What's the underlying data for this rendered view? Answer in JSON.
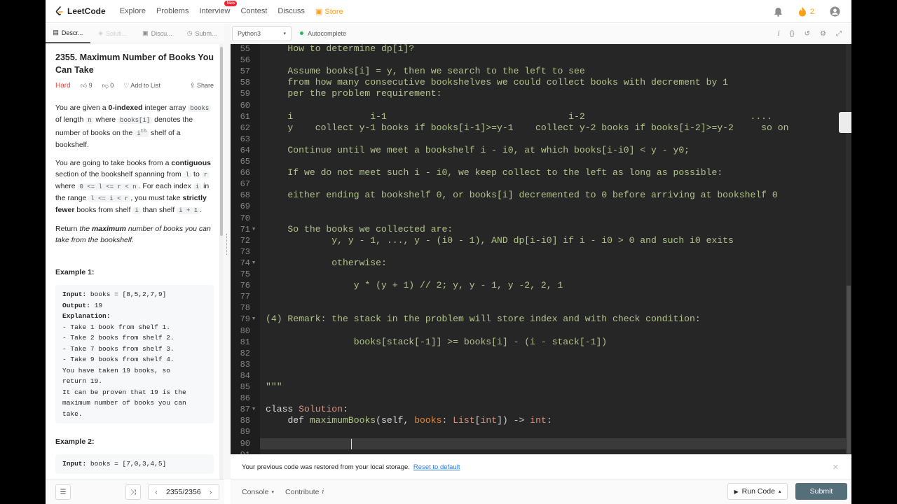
{
  "nav": {
    "logo": "LeetCode",
    "items": [
      "Explore",
      "Problems",
      "Interview",
      "Contest",
      "Discuss"
    ],
    "new_badge": "New",
    "store": "Store",
    "streak_count": "2"
  },
  "left_tabs": [
    "Descr...",
    "Soluti...",
    "Discu...",
    "Subm..."
  ],
  "problem": {
    "title": "2355. Maximum Number of Books You Can Take",
    "difficulty": "Hard",
    "likes": "9",
    "dislikes": "0",
    "add_to_list": "Add to List",
    "share": "Share",
    "p1": {
      "a": "You are given a ",
      "b": "0-indexed",
      "c": " integer array ",
      "d": "books",
      "e": " of length ",
      "f": "n",
      "g": " where ",
      "h": "books[i]",
      "i": " denotes the number of books on the ",
      "j": "i",
      "k": "th",
      "l": " shelf of a bookshelf."
    },
    "p2": {
      "a": "You are going to take books from a ",
      "b": "contiguous",
      "c": " section of the bookshelf spanning from ",
      "d": "l",
      "e": " to ",
      "f": "r",
      "g": " where ",
      "h": "0 <= l <= r < n",
      "i": ". For each index ",
      "j": "i",
      "k": " in the range ",
      "l": "l <= i < r",
      "m": ", you must take ",
      "n": "strictly fewer",
      "o": " books from shelf ",
      "p": "i",
      "q": " than shelf ",
      "r": "i + 1",
      "s": "."
    },
    "p3": {
      "a": "Return ",
      "b": "the ",
      "c": "maximum",
      "d": " number of books you can take from the bookshelf."
    },
    "example1_title": "Example 1:",
    "example1_lines": [
      {
        "label": "Input:",
        "text": " books = [8,5,2,7,9]"
      },
      {
        "label": "Output:",
        "text": " 19"
      },
      {
        "label": "Explanation:",
        "text": ""
      },
      {
        "label": "",
        "text": "- Take 1 book from shelf 1."
      },
      {
        "label": "",
        "text": "- Take 2 books from shelf 2."
      },
      {
        "label": "",
        "text": "- Take 7 books from shelf 3."
      },
      {
        "label": "",
        "text": "- Take 9 books from shelf 4."
      },
      {
        "label": "",
        "text": "You have taken 19 books, so"
      },
      {
        "label": "",
        "text": "return 19."
      },
      {
        "label": "",
        "text": "It can be proven that 19 is the"
      },
      {
        "label": "",
        "text": "maximum number of books you can"
      },
      {
        "label": "",
        "text": "take."
      }
    ],
    "example2_title": "Example 2:",
    "example2_first": {
      "label": "Input:",
      "text": " books = [7,0,3,4,5]"
    }
  },
  "editor": {
    "language": "Python3",
    "autocomplete": "Autocomplete",
    "line_numbers": [
      "55",
      "56",
      "57",
      "58",
      "59",
      "60",
      "61",
      "62",
      "63",
      "64",
      "65",
      "66",
      "67",
      "68",
      "69",
      "70",
      "71",
      "72",
      "73",
      "74",
      "75",
      "76",
      "77",
      "78",
      "79",
      "80",
      "81",
      "82",
      "83",
      "84",
      "85",
      "86",
      "87",
      "88",
      "89",
      "90",
      "91"
    ],
    "lines": [
      "    How to determine dp[i]?",
      "",
      "    Assume books[i] = y, then we search to the left to see",
      "    from how many consecutive bookshelves we could collect books with decrement by 1",
      "    per the problem requirement:",
      "",
      "    i              i-1                                 i-2                              ....",
      "    y    collect y-1 books if books[i-1]>=y-1    collect y-2 books if books[i-2]>=y-2     so on",
      "",
      "    Continue until we meet a bookshelf i - i0, at which books[i-i0] < y - y0;",
      "",
      "    If we do not meet such i - i0, we keep collect to the left as long as possible:",
      "",
      "    either ending at bookshelf 0, or books[i] decremented to 0 before arriving at bookshelf 0",
      "",
      "",
      "    So the books we collected are:",
      "            y, y - 1, ..., y - (i0 - 1), AND dp[i-i0] if i - i0 > 0 and such i0 exits",
      "",
      "            otherwise:",
      "",
      "                y * (y + 1) // 2; y, y - 1, y -2, 2, 1",
      "",
      "",
      "(4) Remark: the stack in the problem will store index and with check condition:",
      "",
      "                books[stack[-1]] >= books[i] - (i - stack[-1])",
      "",
      "",
      "",
      "\"\"\"",
      "",
      "",
      "",
      "",
      "",
      ""
    ],
    "code": {
      "class_kw": "class",
      "class_name": "Solution",
      "colon": ":",
      "def_kw": "def",
      "fn_name": "maximumBooks",
      "open": "(self, ",
      "param": "books",
      "sep": ": ",
      "type_list": "List",
      "bracket_open": "[",
      "type_int": "int",
      "bracket_close": "])",
      "arrow": " -> ",
      "ret": "int",
      "end": ":"
    }
  },
  "notice": {
    "text": "Your previous code was restored from your local storage.",
    "reset": "Reset to default"
  },
  "bottom": {
    "pager": "2355/2356",
    "console": "Console",
    "contribute": "Contribute",
    "run": "Run Code",
    "submit": "Submit"
  },
  "colors": {
    "accent": "#ffa116",
    "hard": "#ef4743",
    "submit": "#546e7a",
    "editor_bg": "#262626",
    "comment_text": "#b3c38c"
  }
}
